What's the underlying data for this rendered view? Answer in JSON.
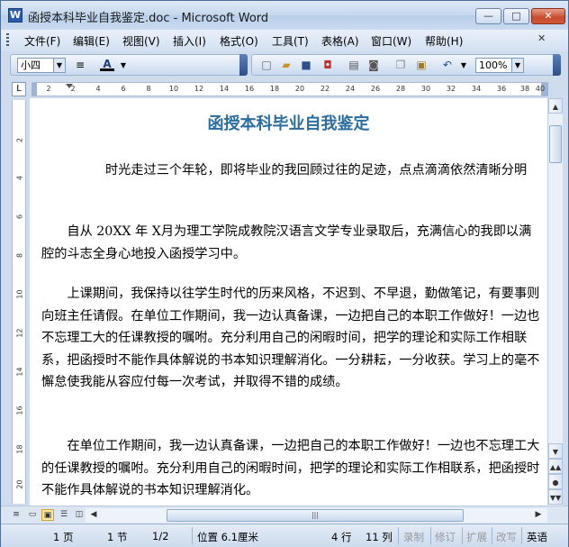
{
  "window": {
    "title": "函授本科毕业自我鉴定.doc - Microsoft Word",
    "app_icon": "W",
    "min": "—",
    "max": "□",
    "close": "✕"
  },
  "menu": [
    "文件(F)",
    "编辑(E)",
    "视图(V)",
    "插入(I)",
    "格式(O)",
    "工具(T)",
    "表格(A)",
    "窗口(W)",
    "帮助(H)"
  ],
  "toolbar": {
    "font_size": "小四",
    "zoom": "100%"
  },
  "ruler": {
    "ticks": [
      "2",
      "2",
      "4",
      "6",
      "8",
      "10",
      "12",
      "14",
      "16",
      "18",
      "20",
      "22",
      "24",
      "26",
      "28",
      "30",
      "32",
      "34",
      "36",
      "38",
      "40"
    ],
    "vticks": [
      "2",
      "4",
      "6",
      "8",
      "10",
      "12",
      "14",
      "16",
      "18",
      "20"
    ]
  },
  "document": {
    "title": "函授本科毕业自我鉴定",
    "p1": "　　　　　时光走过三个年轮，即将毕业的我回顾过往的足迹，点点滴滴依然清晰分明",
    "p2": "　　自从 20XX 年 X月为理工学院成教院汉语言文学专业录取后，充满信心的我即以满腔的斗志全身心地投入函授学习中。",
    "p3": "　　上课期间，我保持以往学生时代的历来风格，不迟到、不早退，勤做笔记，有要事则向班主任请假。在单位工作期间，我一边认真备课，一边把自己的本职工作做好！一边也不忘理工大的任课教授的嘱咐。充分利用自己的闲暇时间，把学的理论和实际工作相联系，把函授时不能作具体解说的书本知识理解消化。一分耕耘，一分收获。学习上的毫不懈怠使我能从容应付每一次考试，并取得不错的成绩。",
    "p4": "　　在单位工作期间，我一边认真备课，一边把自己的本职工作做好！一边也不忘理工大的任课教授的嘱咐。充分利用自己的闲暇时间，把学的理论和实际工作相联系，把函授时不能作具体解说的书本知识理解消化。"
  },
  "status": {
    "page": "1 页",
    "section": "1 节",
    "pages": "1/2",
    "position": "位置 6.1厘米",
    "row": "4 行",
    "col": "11 列",
    "rec": "录制",
    "trk": "修订",
    "ext": "扩展",
    "ovr": "改写",
    "lang": "英语"
  },
  "colors": {
    "title_blue": "#2b6d9c",
    "chrome": "#cfdcee"
  }
}
